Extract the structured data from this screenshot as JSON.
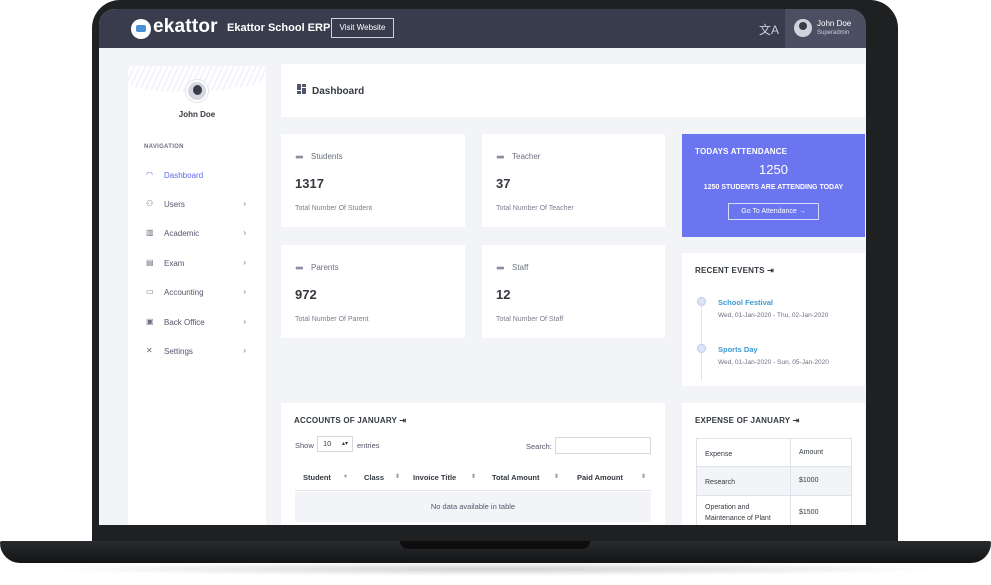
{
  "topbar": {
    "logo_text": "ekattor",
    "app_name": "Ekattor School ERP",
    "visit_website": "Visit Website",
    "language_icon": "translate-icon",
    "user": {
      "name": "John Doe",
      "role": "Superadmin"
    }
  },
  "sidebar": {
    "profile_name": "John Doe",
    "nav_title": "NAVIGATION",
    "items": [
      {
        "label": "Dashboard",
        "icon": "gauge-icon",
        "active": true
      },
      {
        "label": "Users",
        "icon": "user-icon"
      },
      {
        "label": "Academic",
        "icon": "building-icon"
      },
      {
        "label": "Exam",
        "icon": "clipboard-icon"
      },
      {
        "label": "Accounting",
        "icon": "briefcase-icon"
      },
      {
        "label": "Back Office",
        "icon": "gift-icon"
      },
      {
        "label": "Settings",
        "icon": "tools-icon"
      }
    ]
  },
  "dashboard": {
    "title": "Dashboard"
  },
  "stats": {
    "students": {
      "label": "Students",
      "value": "1317",
      "sub": "Total Number Of Student"
    },
    "teacher": {
      "label": "Teacher",
      "value": "37",
      "sub": "Total Number Of Teacher"
    },
    "parents": {
      "label": "Parents",
      "value": "972",
      "sub": "Total Number Of Parent"
    },
    "staff": {
      "label": "Staff",
      "value": "12",
      "sub": "Total Number Of Staff"
    }
  },
  "attendance": {
    "title": "TODAYS ATTENDANCE",
    "count": "1250",
    "sub": "1250 STUDENTS ARE ATTENDING TODAY",
    "button": "Go To Attendance →"
  },
  "events": {
    "title": "RECENT EVENTS",
    "items": [
      {
        "name": "School Festival",
        "date": "Wed, 01-Jan-2020 - Thu, 02-Jan-2020"
      },
      {
        "name": "Sports Day",
        "date": "Wed, 01-Jan-2020 - Sun, 05-Jan-2020"
      }
    ]
  },
  "accounts": {
    "title": "ACCOUNTS OF JANUARY",
    "show_label": "Show",
    "show_value": "10",
    "entries_label": "entries",
    "search_label": "Search:",
    "columns": [
      "Student",
      "Class",
      "Invoice Title",
      "Total Amount",
      "Paid Amount"
    ],
    "empty": "No data available in table"
  },
  "expense": {
    "title": "EXPENSE OF JANUARY",
    "columns": [
      "Expense",
      "Amount"
    ],
    "rows": [
      {
        "expense": "Research",
        "amount": "$1000"
      },
      {
        "expense": "Operation and Maintenance of Plant",
        "amount": "$1500"
      }
    ]
  },
  "colors": {
    "topbar": "#383c4d",
    "accent": "#6b75f0",
    "active_nav": "#5a6cf3",
    "link": "#3d9ad1",
    "background": "#f3f4f8"
  }
}
